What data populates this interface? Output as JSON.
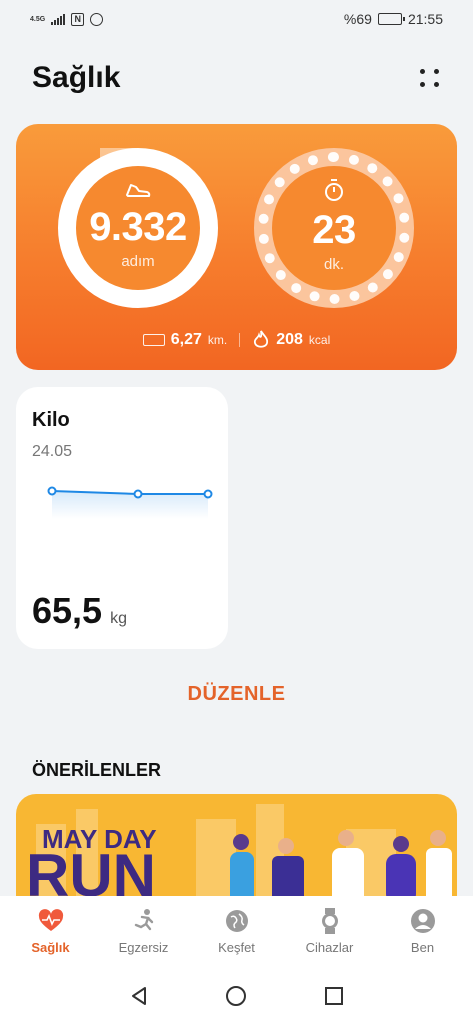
{
  "status": {
    "network": "4.5G",
    "battery_text": "%69",
    "time": "21:55",
    "battery_level": 0.69
  },
  "header": {
    "title": "Sağlık",
    "more_icon": "more-dots-icon"
  },
  "activity": {
    "steps_value": "9.332",
    "steps_unit": "adım",
    "steps_icon": "shoe-icon",
    "time_value": "23",
    "time_unit": "dk.",
    "time_icon": "stopwatch-icon",
    "distance_value": "6,27",
    "distance_unit": "km.",
    "calories_value": "208",
    "calories_unit": "kcal",
    "colors": {
      "card_top": "#f99b3b",
      "card_bottom": "#f26622"
    }
  },
  "weight": {
    "title": "Kilo",
    "date": "24.05",
    "value": "65,5",
    "unit": "kg"
  },
  "edit_label": "DÜZENLE",
  "recommended": {
    "title": "ÖNERİLENLER",
    "promo_line1": "MAY DAY",
    "promo_line2": "RUN"
  },
  "nav": {
    "items": [
      {
        "label": "Sağlık",
        "icon": "heart-pulse-icon",
        "active": true
      },
      {
        "label": "Egzersiz",
        "icon": "running-icon",
        "active": false
      },
      {
        "label": "Keşfet",
        "icon": "globe-icon",
        "active": false
      },
      {
        "label": "Cihazlar",
        "icon": "watch-icon",
        "active": false
      },
      {
        "label": "Ben",
        "icon": "person-icon",
        "active": false
      }
    ]
  },
  "accent_color": "#e4632a"
}
